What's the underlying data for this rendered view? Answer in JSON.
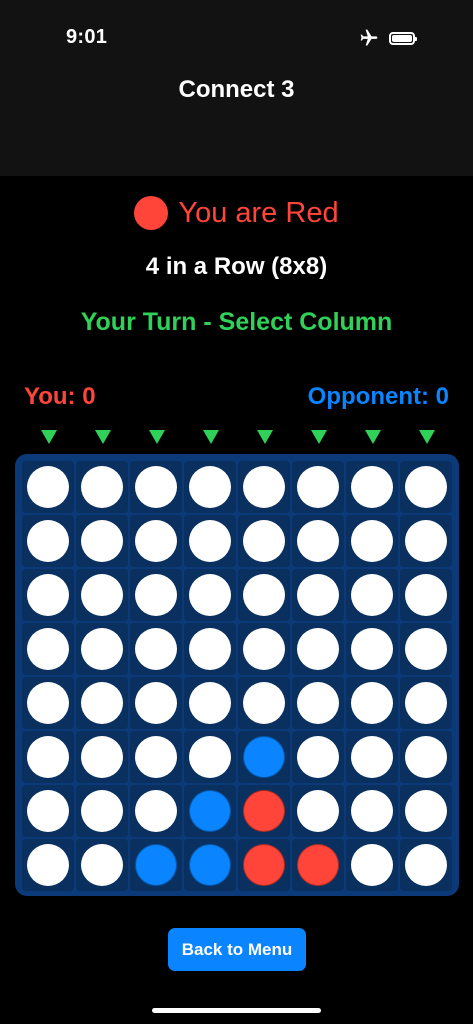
{
  "status_bar": {
    "time": "9:01",
    "icons": [
      "airplane-icon",
      "battery-icon"
    ]
  },
  "nav": {
    "title": "Connect 3"
  },
  "game": {
    "player_label": "You are Red",
    "mode": "4 in a Row (8x8)",
    "turn_status": "Your Turn - Select Column",
    "score_you": "You: 0",
    "score_opponent": "Opponent: 0",
    "columns": 8,
    "rows": 8,
    "board": [
      [
        "empty",
        "empty",
        "empty",
        "empty",
        "empty",
        "empty",
        "empty",
        "empty"
      ],
      [
        "empty",
        "empty",
        "empty",
        "empty",
        "empty",
        "empty",
        "empty",
        "empty"
      ],
      [
        "empty",
        "empty",
        "empty",
        "empty",
        "empty",
        "empty",
        "empty",
        "empty"
      ],
      [
        "empty",
        "empty",
        "empty",
        "empty",
        "empty",
        "empty",
        "empty",
        "empty"
      ],
      [
        "empty",
        "empty",
        "empty",
        "empty",
        "empty",
        "empty",
        "empty",
        "empty"
      ],
      [
        "empty",
        "empty",
        "empty",
        "empty",
        "blue",
        "empty",
        "empty",
        "empty"
      ],
      [
        "empty",
        "empty",
        "empty",
        "blue",
        "red",
        "empty",
        "empty",
        "empty"
      ],
      [
        "empty",
        "empty",
        "blue",
        "blue",
        "red",
        "red",
        "empty",
        "empty"
      ]
    ]
  },
  "actions": {
    "back_label": "Back to Menu"
  },
  "colors": {
    "red": "#ff453a",
    "blue": "#0a84ff",
    "green": "#30d158",
    "board": "#0c3a78"
  }
}
